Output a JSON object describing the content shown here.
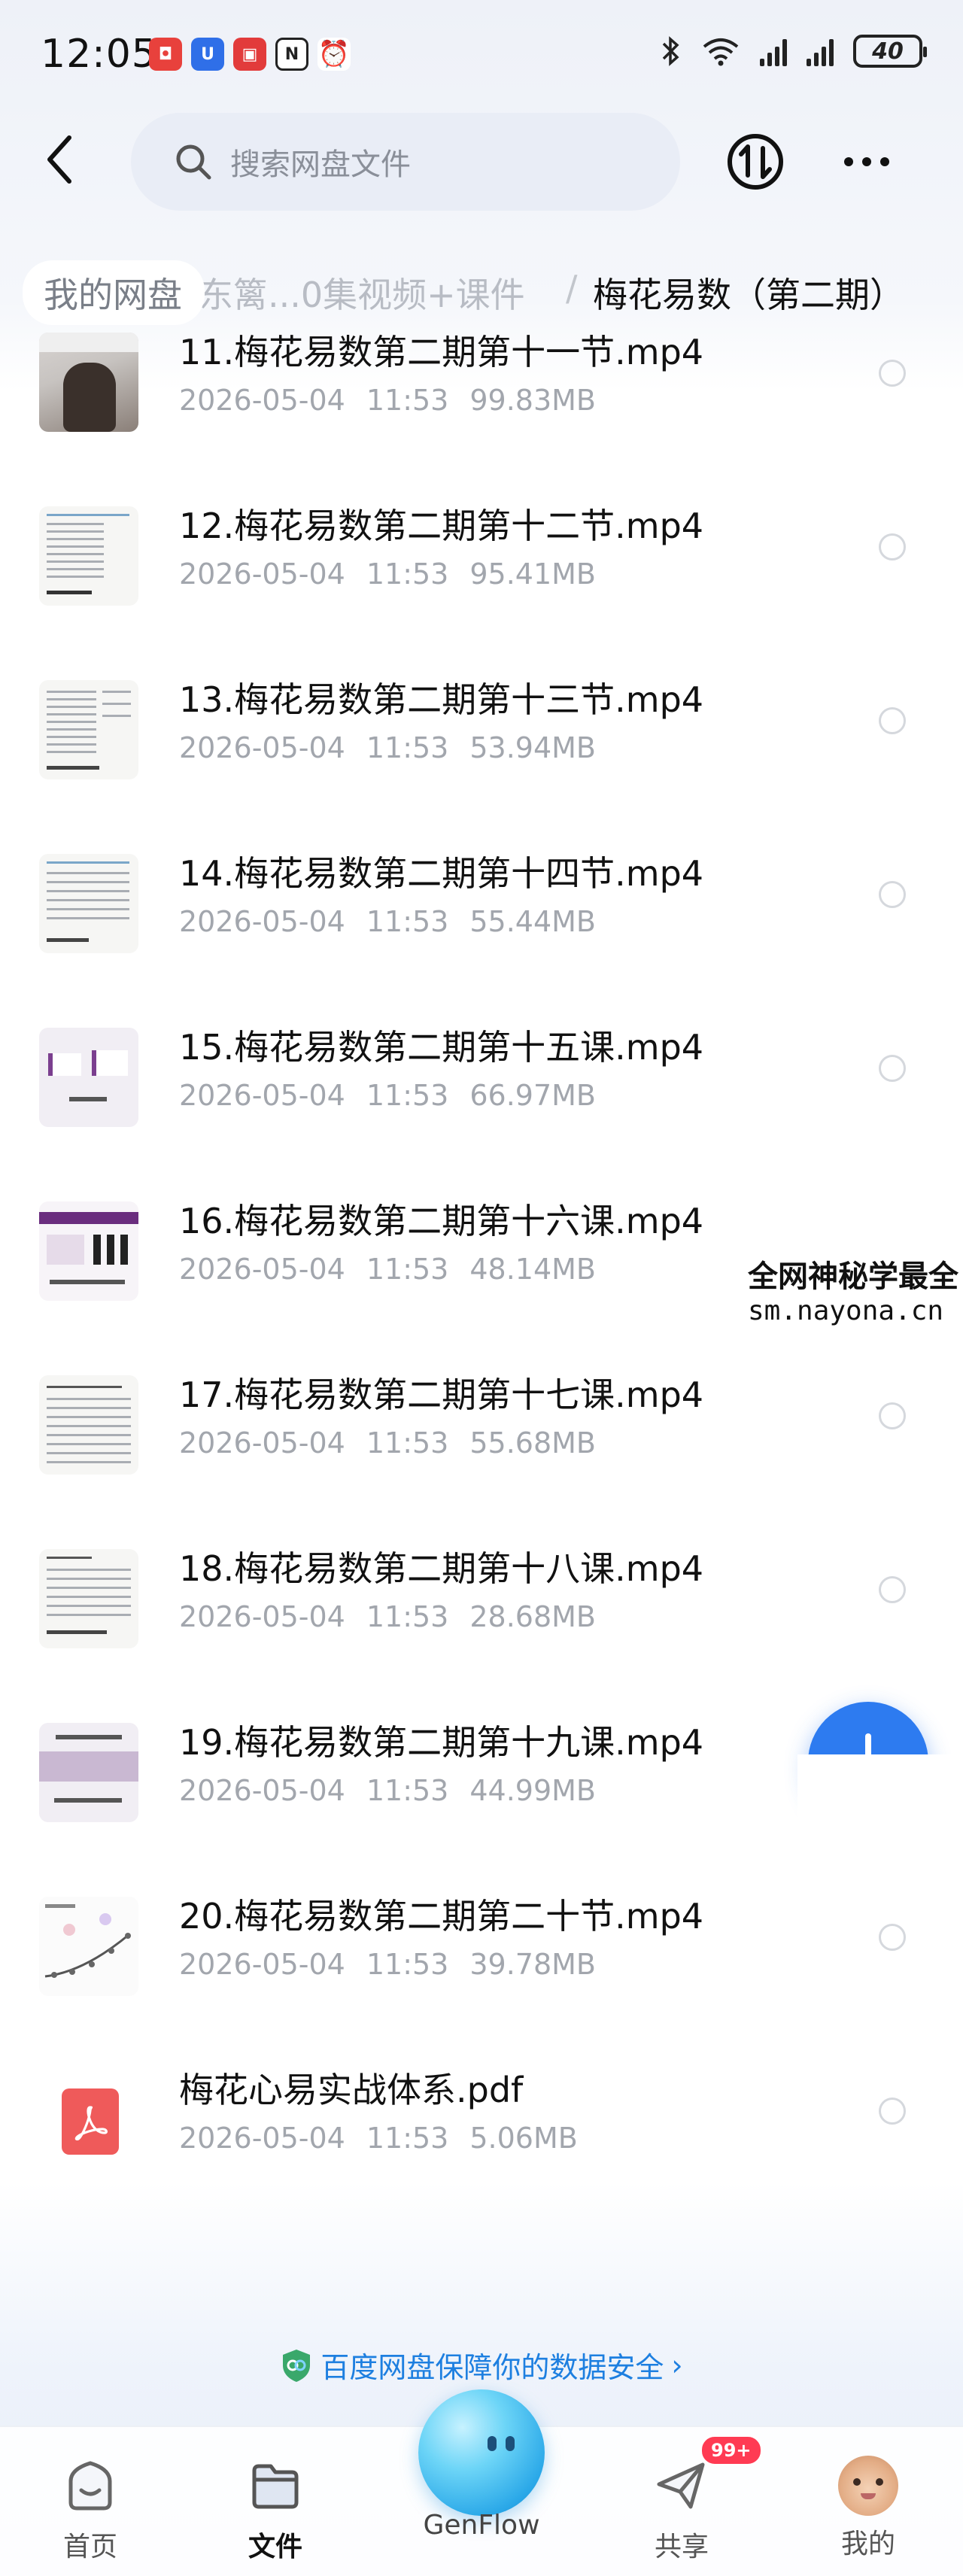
{
  "status_bar": {
    "time": "12:05",
    "battery": "40"
  },
  "header": {
    "search_placeholder": "搜索网盘文件"
  },
  "breadcrumb": {
    "root": "我的网盘",
    "middle": "东篱...0集视频+课件",
    "separator": "/",
    "current": "梅花易数（第二期）"
  },
  "files": [
    {
      "name": "11.梅花易数第二期第十一节.mp4",
      "date": "2026-05-04",
      "time": "11:53",
      "size": "99.83MB"
    },
    {
      "name": "12.梅花易数第二期第十二节.mp4",
      "date": "2026-05-04",
      "time": "11:53",
      "size": "95.41MB"
    },
    {
      "name": "13.梅花易数第二期第十三节.mp4",
      "date": "2026-05-04",
      "time": "11:53",
      "size": "53.94MB"
    },
    {
      "name": "14.梅花易数第二期第十四节.mp4",
      "date": "2026-05-04",
      "time": "11:53",
      "size": "55.44MB"
    },
    {
      "name": "15.梅花易数第二期第十五课.mp4",
      "date": "2026-05-04",
      "time": "11:53",
      "size": "66.97MB"
    },
    {
      "name": "16.梅花易数第二期第十六课.mp4",
      "date": "2026-05-04",
      "time": "11:53",
      "size": "48.14MB"
    },
    {
      "name": "17.梅花易数第二期第十七课.mp4",
      "date": "2026-05-04",
      "time": "11:53",
      "size": "55.68MB"
    },
    {
      "name": "18.梅花易数第二期第十八课.mp4",
      "date": "2026-05-04",
      "time": "11:53",
      "size": "28.68MB"
    },
    {
      "name": "19.梅花易数第二期第十九课.mp4",
      "date": "2026-05-04",
      "time": "11:53",
      "size": "44.99MB"
    },
    {
      "name": "20.梅花易数第二期第二十节.mp4",
      "date": "2026-05-04",
      "time": "11:53",
      "size": "39.78MB"
    },
    {
      "name": "梅花心易实战体系.pdf",
      "date": "2026-05-04",
      "time": "11:53",
      "size": "5.06MB"
    }
  ],
  "watermark": {
    "line1": "全网神秘学最全",
    "line2": "sm.nayona.cn"
  },
  "safety_banner": {
    "text": "百度网盘保障你的数据安全",
    "arrow": "›"
  },
  "bottom_nav": {
    "home": "首页",
    "files": "文件",
    "genflow": "GenFlow",
    "share": "共享",
    "share_badge": "99+",
    "mine": "我的"
  },
  "colors": {
    "accent": "#1d7fe0",
    "badge": "#ff3b53",
    "pdf": "#ef5a5a"
  }
}
